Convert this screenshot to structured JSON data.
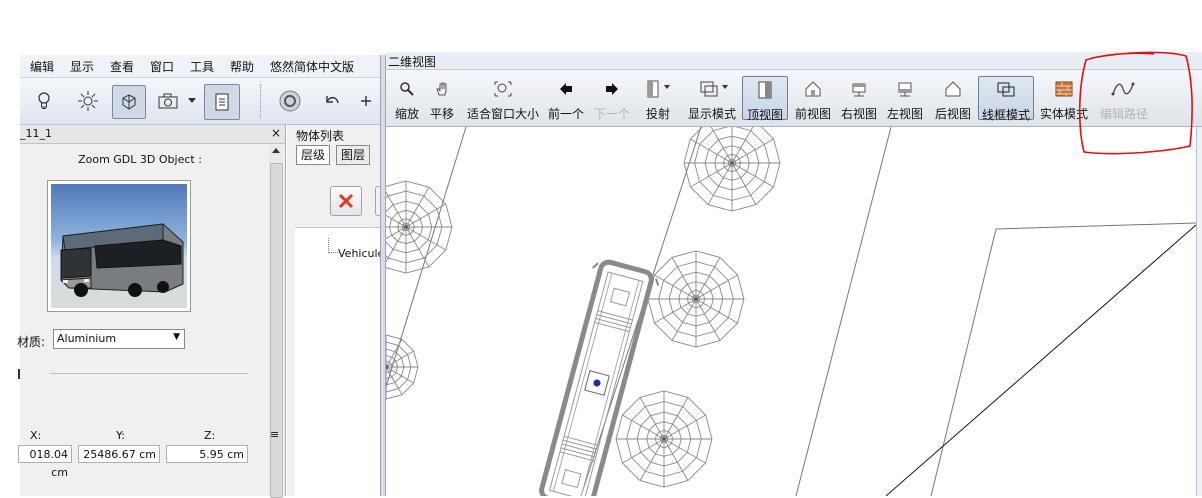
{
  "menu": [
    "编辑",
    "显示",
    "查看",
    "窗口",
    "工具",
    "帮助",
    "悠然简体中文版"
  ],
  "left_toolbar": {
    "icons": [
      "lightbulb-icon",
      "sun-icon",
      "cube-icon",
      "camera-icon",
      "dropdown-arrow-icon",
      "document-icon",
      "orbit-icon",
      "undo-icon",
      "redo-icon"
    ]
  },
  "object_panel": {
    "tab_title": "_11_1",
    "close": "×",
    "preview_title": "Zoom GDL 3D Object :",
    "material_label": "材质:",
    "material_value": "Aluminium",
    "x_label": "X:",
    "y_label": "Y:",
    "z_label": "Z:",
    "x_value": "018.04 cm",
    "y_value": "25486.67 cm",
    "z_value": "5.95 cm"
  },
  "object_list": {
    "title": "物体列表",
    "tabs": [
      "层级",
      "图层"
    ],
    "tree_item": "Vehicule_"
  },
  "view2d": {
    "title": "二维视图",
    "tools": [
      {
        "label": "缩放",
        "icon": "zoom-icon",
        "enabled": true,
        "pressed": false
      },
      {
        "label": "平移",
        "icon": "pan-hand-icon",
        "enabled": true,
        "pressed": false
      },
      {
        "label": "适合窗口大小",
        "icon": "fit-window-icon",
        "enabled": true,
        "pressed": false
      },
      {
        "label": "前一个",
        "icon": "arrow-left-icon",
        "enabled": true,
        "pressed": false
      },
      {
        "label": "下一个",
        "icon": "arrow-right-icon",
        "enabled": false,
        "pressed": false
      },
      {
        "label": "投射",
        "icon": "projection-icon",
        "enabled": true,
        "pressed": false
      },
      {
        "label": "显示模式",
        "icon": "display-mode-icon",
        "enabled": true,
        "pressed": false
      },
      {
        "label": "顶视图",
        "icon": "top-view-icon",
        "enabled": true,
        "pressed": true
      },
      {
        "label": "前视图",
        "icon": "front-view-icon",
        "enabled": true,
        "pressed": false
      },
      {
        "label": "右视图",
        "icon": "right-view-icon",
        "enabled": true,
        "pressed": false
      },
      {
        "label": "左视图",
        "icon": "left-view-icon",
        "enabled": true,
        "pressed": false
      },
      {
        "label": "后视图",
        "icon": "back-view-icon",
        "enabled": true,
        "pressed": false
      },
      {
        "label": "线框模式",
        "icon": "wireframe-icon",
        "enabled": true,
        "pressed": true
      },
      {
        "label": "实体模式",
        "icon": "solid-mode-icon",
        "enabled": true,
        "pressed": false
      },
      {
        "label": "编辑路径",
        "icon": "edit-path-icon",
        "enabled": false,
        "pressed": false
      }
    ]
  },
  "colors": {
    "annotation_red": "#e01010",
    "wire_gray": "#777777",
    "bus_gray": "#8a8a8a",
    "marker_blue": "#1b2fa0"
  }
}
